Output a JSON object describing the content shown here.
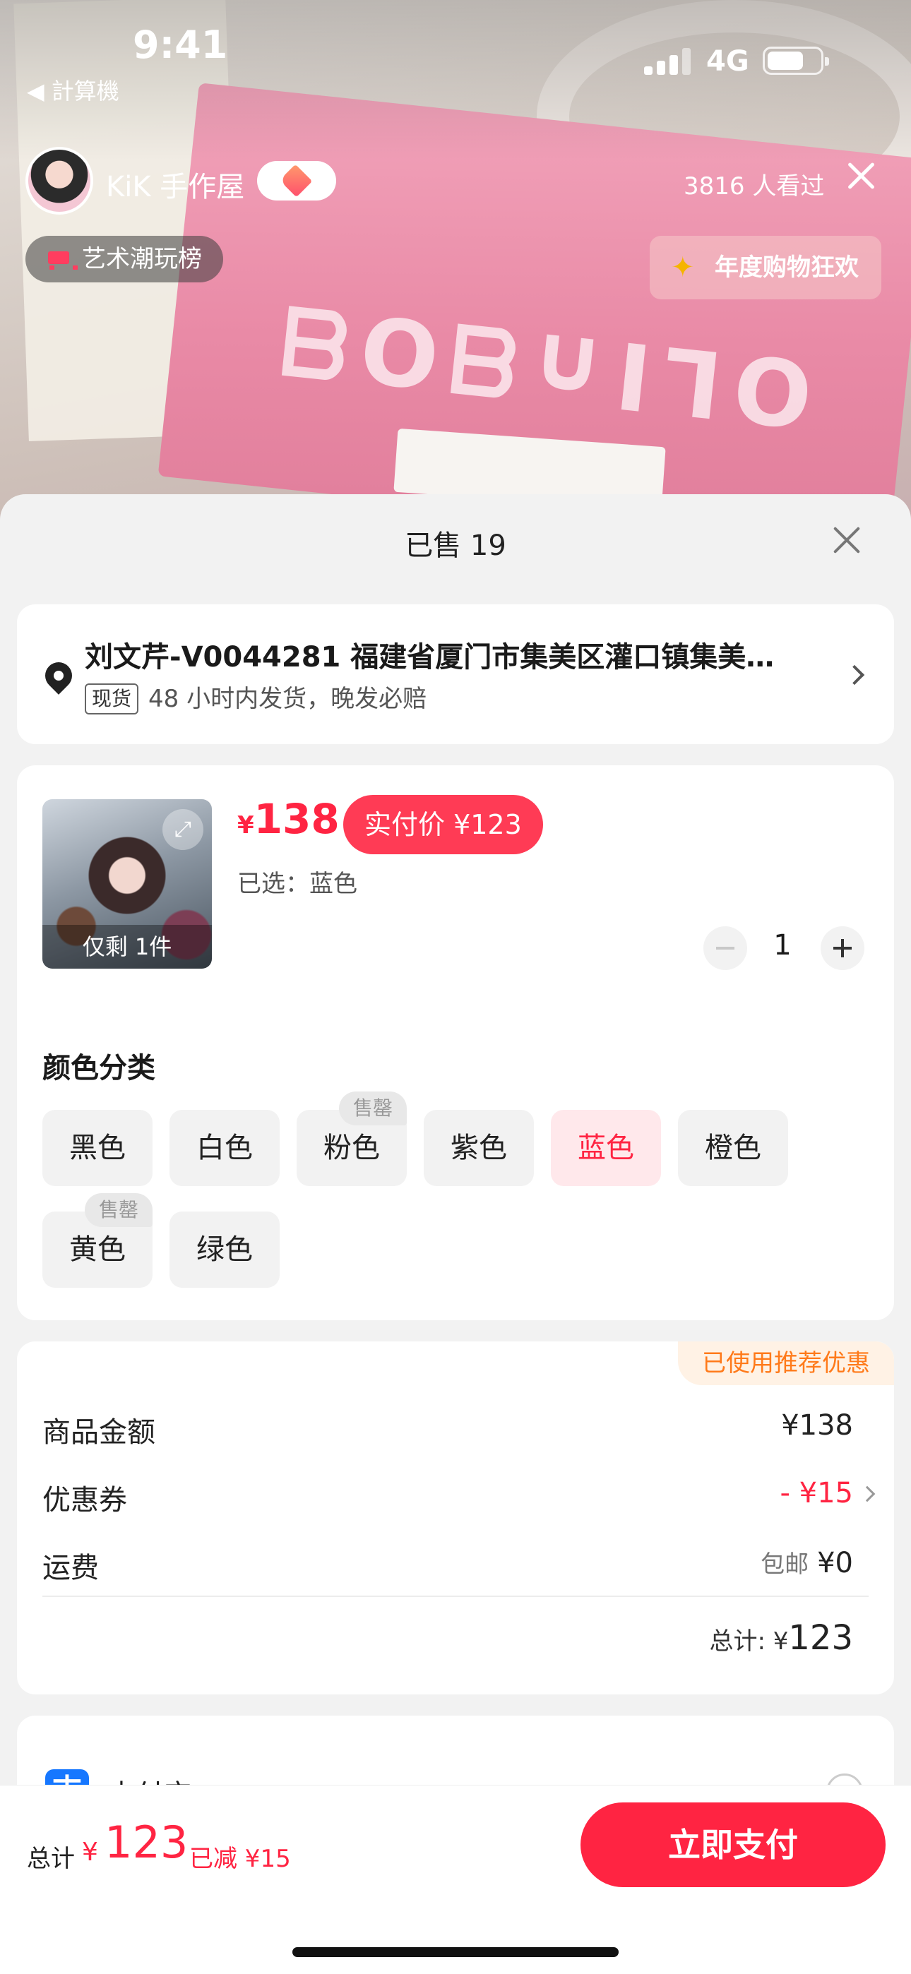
{
  "status_bar": {
    "time": "9:41",
    "back_app": "◀ 計算機",
    "network": "4G"
  },
  "live": {
    "shop_name": "KiK 手作屋",
    "viewers": "3816 人看过",
    "rank_tag": "艺术潮玩榜",
    "promo_tag": "年度购物狂欢"
  },
  "sheet": {
    "title": "已售 19"
  },
  "address": {
    "text": "刘文芹-V0044281 福建省厦门市集美区灌口镇集美…",
    "stock_badge": "现货",
    "shipping_note": "48 小时内发货，晚发必赔"
  },
  "product": {
    "currency": "¥",
    "price": "138",
    "pay_price_label": "实付价 ¥123",
    "selected": "已选：蓝色",
    "stock_left": "仅剩 1件",
    "quantity": "1",
    "color_title": "颜色分类",
    "colors": [
      {
        "label": "黑色",
        "active": false,
        "sold_out": false
      },
      {
        "label": "白色",
        "active": false,
        "sold_out": false
      },
      {
        "label": "粉色",
        "active": false,
        "sold_out": true
      },
      {
        "label": "紫色",
        "active": false,
        "sold_out": false
      },
      {
        "label": "蓝色",
        "active": true,
        "sold_out": false
      },
      {
        "label": "橙色",
        "active": false,
        "sold_out": false
      },
      {
        "label": "黄色",
        "active": false,
        "sold_out": true
      },
      {
        "label": "绿色",
        "active": false,
        "sold_out": false
      }
    ],
    "sold_out_label": "售罄"
  },
  "summary": {
    "used_tag": "已使用推荐优惠",
    "goods_label": "商品金额",
    "goods_value": "¥138",
    "coupon_label": "优惠券",
    "coupon_value": "- ¥15",
    "shipping_label": "运费",
    "shipping_note": "包邮",
    "shipping_value": "¥0",
    "total_label": "总计: ¥",
    "total_value": "123"
  },
  "payment": {
    "method": "支付宝",
    "icon": "支"
  },
  "bottom_bar": {
    "label": "总计",
    "currency": "¥",
    "amount": "123",
    "saved": "已减 ¥15",
    "pay_button": "立即支付"
  },
  "colors": {
    "accent": "#ff2442",
    "orange": "#ff7a1a",
    "alipay": "#1677ff"
  }
}
